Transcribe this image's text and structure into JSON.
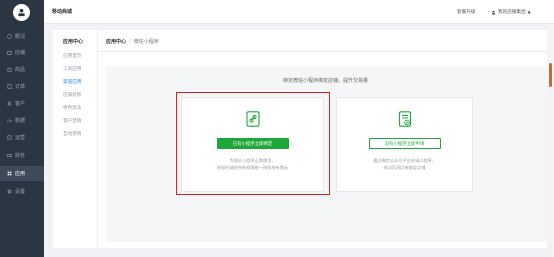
{
  "colors": {
    "accent_green": "#1fa83a",
    "highlight_red": "#e02020",
    "link_blue": "#1a8ae5",
    "nav_bg": "#2b3643"
  },
  "nav": {
    "items": [
      {
        "label": "概况",
        "icon": "dashboard-icon"
      },
      {
        "label": "店铺",
        "icon": "store-icon"
      },
      {
        "label": "商品",
        "icon": "goods-icon"
      },
      {
        "label": "订单",
        "icon": "order-icon"
      },
      {
        "label": "客户",
        "icon": "customer-icon"
      },
      {
        "label": "数据",
        "icon": "data-icon"
      },
      {
        "label": "运营",
        "icon": "operation-icon"
      },
      {
        "label": "财务",
        "icon": "finance-icon"
      },
      {
        "label": "应用",
        "icon": "app-icon",
        "active": true
      },
      {
        "label": "设置",
        "icon": "settings-icon"
      }
    ]
  },
  "topbar": {
    "store_name": "移动商城",
    "upgrade": "套餐升级",
    "user": "我的店铺集团"
  },
  "subnav": {
    "title": "应用中心",
    "items": [
      {
        "label": "应用首页"
      },
      {
        "label": "工具应用"
      },
      {
        "label": "渠道应用",
        "active": true
      },
      {
        "label": "店铺装修"
      },
      {
        "label": "特色玩法"
      },
      {
        "label": "客户营销"
      },
      {
        "label": "互动营销"
      }
    ]
  },
  "breadcrumb": {
    "root": "应用中心",
    "separator": "/",
    "current": "微信小程序"
  },
  "main": {
    "headline": "绑定微信小程序绑定店铺，提升交易量",
    "card_bind": {
      "icon": "phone-link-icon",
      "button": "已有小程序立即绑定",
      "desc_1": "为保证小程序正常使用，",
      "desc_2": "授权时请把所有权限统一授权给有赞云"
    },
    "card_apply": {
      "icon": "document-check-icon",
      "button": "没有小程序立即申请",
      "desc_1": "通过微信公众号平台申请小程序，",
      "desc_2": "成功后再回来绑定店铺"
    }
  }
}
